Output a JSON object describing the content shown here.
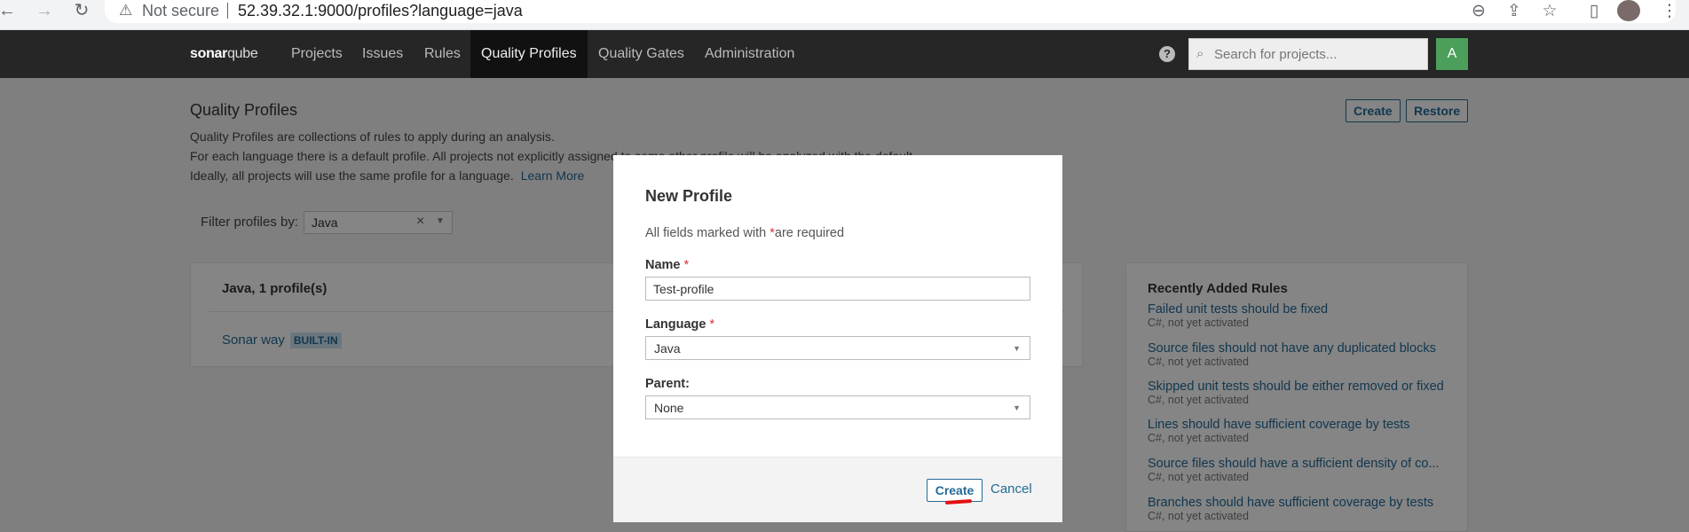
{
  "browser": {
    "security_warning": "Not secure",
    "url": "52.39.32.1:9000/profiles?language=java"
  },
  "nav": {
    "logo_bold": "sonar",
    "logo_light": "qube",
    "items": [
      "Projects",
      "Issues",
      "Rules",
      "Quality Profiles",
      "Quality Gates",
      "Administration"
    ],
    "active_item": "Quality Profiles",
    "help": "?",
    "search_placeholder": "Search for projects...",
    "avatar_letter": "A"
  },
  "page": {
    "title": "Quality Profiles",
    "desc_lines": [
      "Quality Profiles are collections of rules to apply during an analysis.",
      "For each language there is a default profile. All projects not explicitly assigned to some other profile will be analyzed with the default.",
      "Ideally, all projects will use the same profile for a language."
    ],
    "learn_more": "Learn More",
    "create_label": "Create",
    "restore_label": "Restore",
    "filter_label": "Filter profiles by:",
    "filter_value": "Java",
    "filter_clear": "×",
    "language_card": {
      "heading": "Java, 1 profile(s)",
      "profile_name": "Sonar way",
      "profile_badge": "BUILT-IN"
    },
    "recent_rules": {
      "title": "Recently Added Rules",
      "items": [
        {
          "name": "Failed unit tests should be fixed",
          "meta": "C#, not yet activated"
        },
        {
          "name": "Source files should not have any duplicated blocks",
          "meta": "C#, not yet activated"
        },
        {
          "name": "Skipped unit tests should be either removed or fixed",
          "meta": "C#, not yet activated"
        },
        {
          "name": "Lines should have sufficient coverage by tests",
          "meta": "C#, not yet activated"
        },
        {
          "name": "Source files should have a sufficient density of co...",
          "meta": "C#, not yet activated"
        },
        {
          "name": "Branches should have sufficient coverage by tests",
          "meta": "C#, not yet activated"
        }
      ]
    }
  },
  "modal": {
    "title": "New Profile",
    "required_prefix": "All fields marked with",
    "required_star": "*",
    "required_suffix": "are required",
    "name_label": "Name",
    "name_value": "Test-profile",
    "language_label": "Language",
    "language_value": "Java",
    "parent_label": "Parent:",
    "parent_value": "None",
    "create_label": "Create",
    "cancel_label": "Cancel"
  }
}
